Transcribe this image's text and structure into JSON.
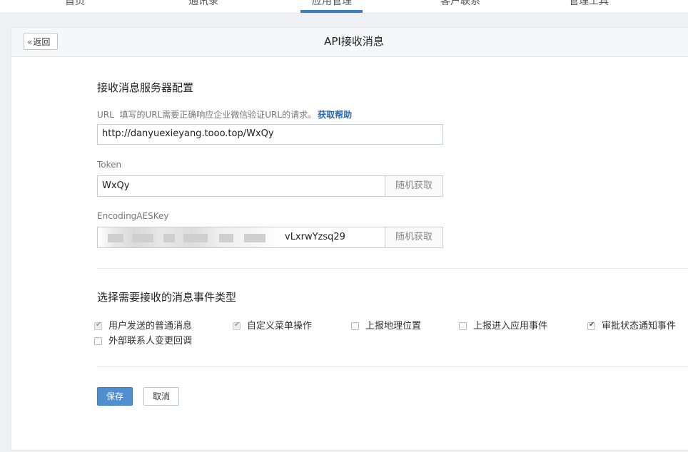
{
  "nav": {
    "tabs": [
      "首页",
      "通讯录",
      "应用管理",
      "客户联系",
      "管理工具"
    ],
    "active_tab": "应用管理",
    "accent_color": "#3a7ec4"
  },
  "header": {
    "back_label": "返回",
    "back_icon": "double-chevron-left-icon",
    "title": "API接收消息"
  },
  "server_config": {
    "section_title": "接收消息服务器配置",
    "url": {
      "label": "URL",
      "hint": "填写的URL需要正确响应企业微信验证URL的请求。",
      "help_link": "获取帮助",
      "value": "http://danyuexieyang.tooo.top/WxQy"
    },
    "token": {
      "label": "Token",
      "value": "WxQy",
      "random_button": "随机获取"
    },
    "aes_key": {
      "label": "EncodingAESKey",
      "visible_value_suffix": "vLxrwYzsq29",
      "random_button": "随机获取"
    }
  },
  "events": {
    "section_title": "选择需要接收的消息事件类型",
    "options": [
      {
        "label": "用户发送的普通消息",
        "checked": true,
        "disabled": true
      },
      {
        "label": "自定义菜单操作",
        "checked": true,
        "disabled": true
      },
      {
        "label": "上报地理位置",
        "checked": false,
        "disabled": false
      },
      {
        "label": "上报进入应用事件",
        "checked": false,
        "disabled": false
      },
      {
        "label": "审批状态通知事件",
        "checked": true,
        "disabled": false
      },
      {
        "label": "外部联系人变更回调",
        "checked": false,
        "disabled": false
      }
    ]
  },
  "actions": {
    "save_label": "保存",
    "cancel_label": "取消",
    "primary_color": "#4f8ed0"
  }
}
